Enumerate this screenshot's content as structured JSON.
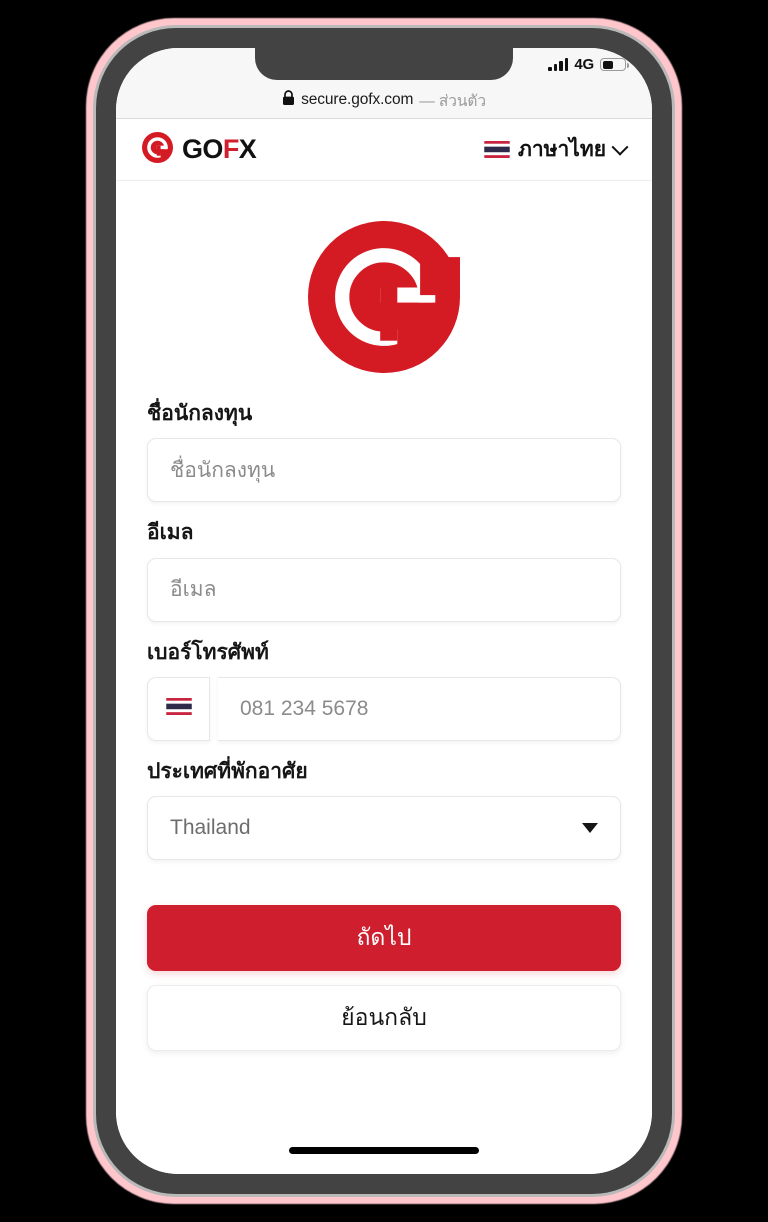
{
  "device": {
    "bezel_color": "#434343",
    "glow_color": "#ffc6cc",
    "screen_bg": "#ffffff"
  },
  "status_bar": {
    "network": "4G",
    "battery_percent": 52,
    "signal_bars": 4
  },
  "browser": {
    "lock_icon": "lock-icon",
    "url": "secure.gofx.com",
    "private_suffix": "— ส่วนตัว"
  },
  "header": {
    "brand_go": "GO",
    "brand_f": "F",
    "brand_x": "X",
    "brand_mark": "gofx-logo-icon",
    "language": {
      "flag": "thailand-flag-icon",
      "label": "ภาษาไทย",
      "chevron": "chevron-down-icon"
    }
  },
  "hero": {
    "logo_icon": "gofx-circle-logo-icon",
    "logo_color": "#d41b24"
  },
  "form": {
    "fields": [
      {
        "name": "investor-name",
        "label": "ชื่อนักลงทุน",
        "placeholder": "ชื่อนักลงทุน",
        "value": ""
      },
      {
        "name": "email",
        "label": "อีเมล",
        "placeholder": "อีเมล",
        "value": ""
      },
      {
        "name": "phone",
        "label": "เบอร์โทรศัพท์",
        "placeholder": "081 234 5678",
        "value": "",
        "prefix_flag": "thailand-flag-icon"
      },
      {
        "name": "country",
        "label": "ประเทศที่พักอาศัย",
        "selected": "Thailand",
        "caret": "caret-down-icon"
      }
    ]
  },
  "actions": {
    "primary_label": "ถัดไป",
    "secondary_label": "ย้อนกลับ",
    "primary_color": "#cf1f2e"
  }
}
